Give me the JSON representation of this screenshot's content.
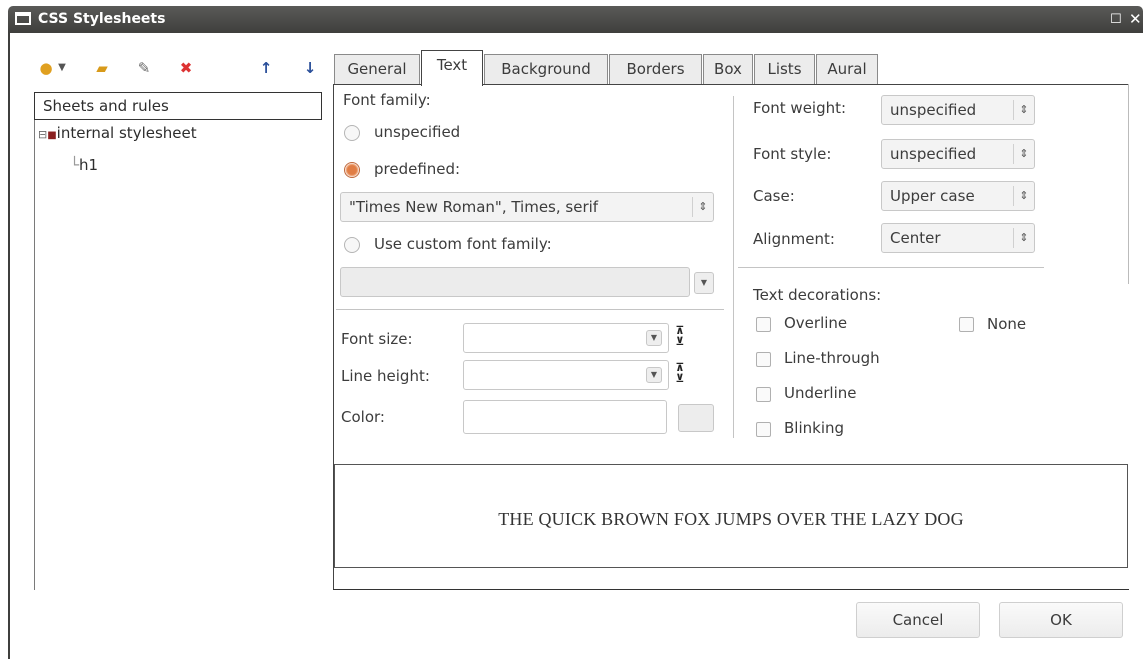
{
  "window": {
    "title": "CSS Stylesheets"
  },
  "toolbar": {
    "icons": [
      "new-stylesheet-icon",
      "dropdown-arrow-icon",
      "open-folder-icon",
      "edit-icon",
      "delete-icon",
      "move-up-icon",
      "move-down-icon"
    ]
  },
  "tree": {
    "header": "Sheets and rules",
    "items": [
      {
        "label": "internal stylesheet",
        "expanded": true
      },
      {
        "label": "h1"
      }
    ]
  },
  "tabs": [
    "General",
    "Text",
    "Background",
    "Borders",
    "Box",
    "Lists",
    "Aural"
  ],
  "active_tab": "Text",
  "font_family": {
    "label": "Font family:",
    "option_unspecified": "unspecified",
    "option_predefined": "predefined:",
    "selected_option": "predefined",
    "predefined_value": "\"Times New Roman\", Times, serif",
    "option_custom": "Use custom font family:",
    "custom_value": ""
  },
  "font_size": {
    "label": "Font size:",
    "value": ""
  },
  "line_height": {
    "label": "Line height:",
    "value": ""
  },
  "color": {
    "label": "Color:",
    "value": ""
  },
  "font_weight": {
    "label": "Font weight:",
    "value": "unspecified"
  },
  "font_style": {
    "label": "Font style:",
    "value": "unspecified"
  },
  "case": {
    "label": "Case:",
    "value": "Upper case"
  },
  "alignment": {
    "label": "Alignment:",
    "value": "Center"
  },
  "text_decorations": {
    "label": "Text decorations:",
    "overline": "Overline",
    "none": "None",
    "line_through": "Line-through",
    "underline": "Underline",
    "blinking": "Blinking"
  },
  "preview": {
    "text": "THE QUICK BROWN FOX JUMPS OVER THE LAZY DOG"
  },
  "buttons": {
    "cancel": "Cancel",
    "ok": "OK"
  },
  "colors": {
    "titlebar": "#4a4a48",
    "radio_selected": "#e07d45"
  }
}
